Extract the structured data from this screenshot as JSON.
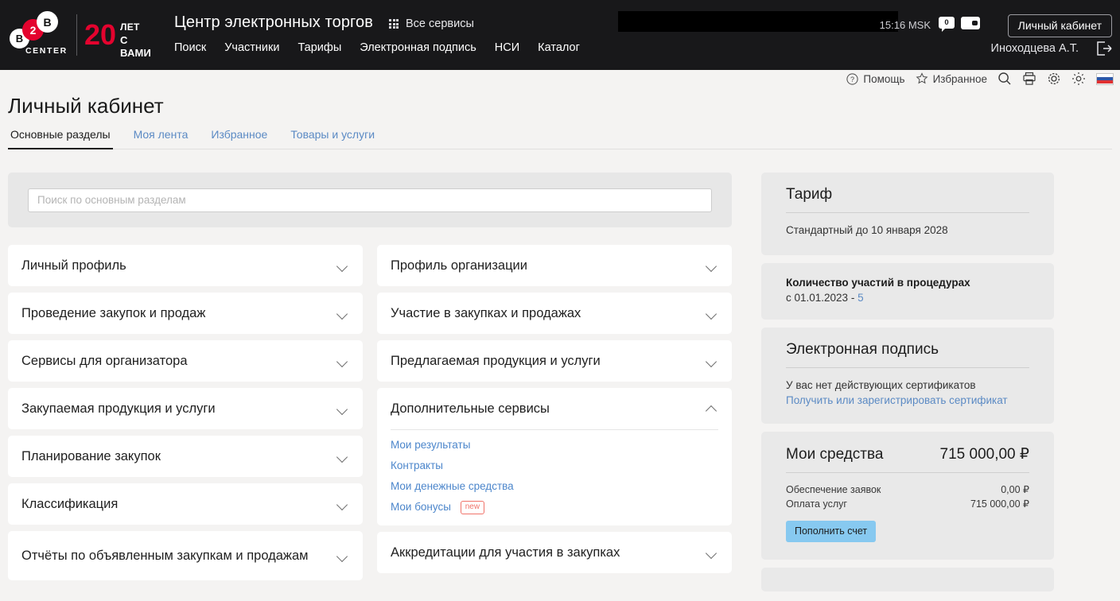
{
  "header": {
    "logo": {
      "b1": "B",
      "two": "2",
      "b2": "B",
      "center": "CENTER",
      "twenty": "20",
      "years": "ЛЕТ",
      "withyou": "С ВАМИ"
    },
    "brand_title": "Центр электронных торгов",
    "all_services": "Все сервисы",
    "nav": [
      {
        "label": "Поиск"
      },
      {
        "label": "Участники"
      },
      {
        "label": "Тарифы"
      },
      {
        "label": "Электронная подпись"
      },
      {
        "label": "НСИ"
      },
      {
        "label": "Каталог"
      }
    ],
    "clock": "15:16 MSK",
    "messages_count": "0",
    "cabinet_button": "Личный кабинет",
    "username": "Иноходцева А.Т."
  },
  "utility": {
    "help": "Помощь",
    "favorites": "Избранное",
    "icons": [
      "search-icon",
      "print-icon",
      "gear-icon",
      "brightness-icon",
      "ru-flag-icon"
    ]
  },
  "page": {
    "title": "Личный кабинет",
    "tabs": [
      {
        "label": "Основные разделы",
        "active": true
      },
      {
        "label": "Моя лента",
        "active": false
      },
      {
        "label": "Избранное",
        "active": false
      },
      {
        "label": "Товары и услуги",
        "active": false
      }
    ]
  },
  "search": {
    "value": "",
    "placeholder": "Поиск по основным разделам"
  },
  "sections": {
    "left": [
      {
        "title": "Личный профиль",
        "expanded": false
      },
      {
        "title": "Проведение закупок и продаж",
        "expanded": false
      },
      {
        "title": "Сервисы для организатора",
        "expanded": false
      },
      {
        "title": "Закупаемая продукция и услуги",
        "expanded": false
      },
      {
        "title": "Планирование закупок",
        "expanded": false
      },
      {
        "title": "Классификация",
        "expanded": false
      },
      {
        "title": "Отчёты по объявленным закупкам и продажам",
        "expanded": false,
        "tall": true
      }
    ],
    "right": [
      {
        "title": "Профиль организации",
        "expanded": false
      },
      {
        "title": "Участие в закупках и продажах",
        "expanded": false
      },
      {
        "title": "Предлагаемая продукция и услуги",
        "expanded": false
      },
      {
        "title": "Дополнительные сервисы",
        "expanded": true,
        "links": [
          {
            "label": "Мои результаты",
            "badge": ""
          },
          {
            "label": "Контракты",
            "badge": ""
          },
          {
            "label": "Мои денежные средства",
            "badge": ""
          },
          {
            "label": "Мои бонусы",
            "badge": "new"
          }
        ]
      },
      {
        "title": "Аккредитации для участия в закупках",
        "expanded": false
      }
    ]
  },
  "sidebar": {
    "tariff": {
      "title": "Тариф",
      "value": "Стандартный до 10 января 2028"
    },
    "participations": {
      "title": "Количество участий в процедурах",
      "period_prefix": "с 01.01.2023 - ",
      "count": "5"
    },
    "signature": {
      "title": "Электронная подпись",
      "status": "У вас нет действующих сертификатов",
      "link": "Получить или зарегистрировать сертификат"
    },
    "funds": {
      "title": "Мои средства",
      "total": "715 000,00 ₽",
      "rows": [
        {
          "label": "Обеспечение заявок",
          "value": "0,00 ₽"
        },
        {
          "label": "Оплата услуг",
          "value": "715 000,00 ₽"
        }
      ],
      "topup_button": "Пополнить счет"
    }
  },
  "colors": {
    "page_bg": "#f4f3f2",
    "header_bg": "#18181a",
    "card_bg": "#e9e9e9",
    "accent_red": "#e4032e",
    "link_blue": "#4c86cb",
    "badge_red": "#f0736a",
    "button_blue": "#87c9f0"
  }
}
